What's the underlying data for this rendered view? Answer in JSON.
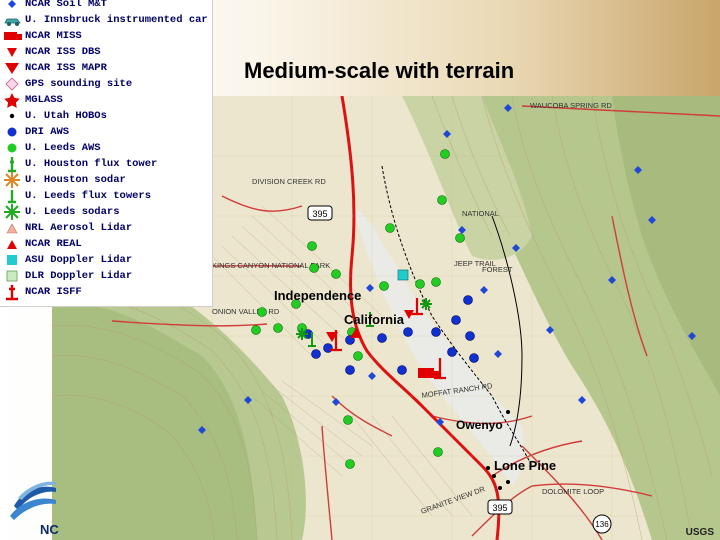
{
  "title": "Medium-scale with terrain",
  "legend": [
    {
      "label": "NCAR Soil M&T",
      "icon": "blue-diamond",
      "color": "#1f47d8"
    },
    {
      "label": "U. Innsbruck instrumented car",
      "icon": "teal-car",
      "color": "#3fa7a8"
    },
    {
      "label": "NCAR MISS",
      "icon": "red-truck",
      "color": "#e00000"
    },
    {
      "label": "NCAR ISS DBS",
      "icon": "red-triangle-down",
      "color": "#e00000"
    },
    {
      "label": "NCAR ISS MAPR",
      "icon": "red-triangle-down-large",
      "color": "#e00000"
    },
    {
      "label": "GPS sounding site",
      "icon": "pink-diamond",
      "color": "#f0a0c8"
    },
    {
      "label": "MGLASS",
      "icon": "red-star",
      "color": "#e00000"
    },
    {
      "label": "U. Utah HOBOs",
      "icon": "black-dot",
      "color": "#000000"
    },
    {
      "label": "DRI AWS",
      "icon": "blue-circle",
      "color": "#1030d0"
    },
    {
      "label": "U. Leeds AWS",
      "icon": "green-circle",
      "color": "#22cc22"
    },
    {
      "label": "U. Houston flux tower",
      "icon": "green-tower",
      "color": "#22aa22"
    },
    {
      "label": "U. Houston sodar",
      "icon": "orange-sodar",
      "color": "#d9892a"
    },
    {
      "label": "U. Leeds flux towers",
      "icon": "green-tower-small",
      "color": "#22aa22"
    },
    {
      "label": "U. Leeds sodars",
      "icon": "green-sodar",
      "color": "#22aa22"
    },
    {
      "label": "NRL Aerosol Lidar",
      "icon": "salmon-triangle",
      "color": "#f0a080"
    },
    {
      "label": "NCAR REAL",
      "icon": "red-triangle-up",
      "color": "#e00000"
    },
    {
      "label": "ASU Doppler Lidar",
      "icon": "cyan-square",
      "color": "#22cccc"
    },
    {
      "label": "DLR Doppler Lidar",
      "icon": "lightgreen-square",
      "color": "#b0e0a0"
    },
    {
      "label": "NCAR ISFF",
      "icon": "red-isff-tower",
      "color": "#e00000"
    }
  ],
  "map": {
    "towns": [
      {
        "name": "Independence"
      },
      {
        "name": "California"
      },
      {
        "name": "Owenyo"
      },
      {
        "name": "Lone Pine"
      }
    ],
    "map_labels": [
      "WAUCOBA SPRING RD",
      "DIVISION CREEK RD",
      "KINGS CANYON NATIONAL PARK",
      "ONION VALLEY RD",
      "MOFFAT RANCH RD",
      "DOLOMITE LOOP",
      "GRANITE VIEW DR",
      "JEEP TRAIL",
      "NATIONAL",
      "FOREST"
    ],
    "road_shields": [
      "395",
      "395",
      "136"
    ],
    "credit": "USGS"
  },
  "logo": {
    "text": "NC"
  }
}
